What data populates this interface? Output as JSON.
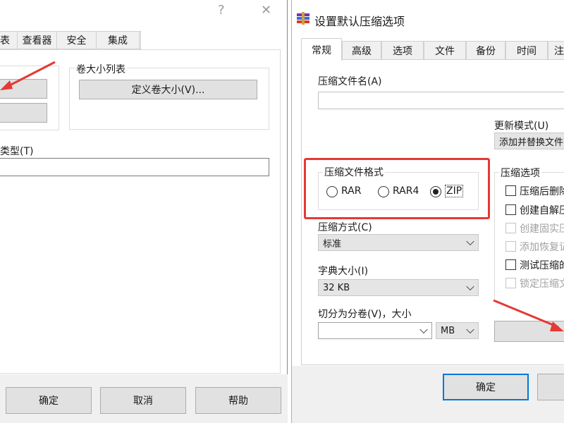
{
  "left_dialog": {
    "title_help": "?",
    "title_close": "✕",
    "tabs": [
      "表",
      "查看器",
      "安全",
      "集成"
    ],
    "volume_group_title": "卷大小列表",
    "define_volume_button": "定义卷大小(V)...",
    "type_label": "类型(T)",
    "type_value": "",
    "footer_buttons": [
      "确定",
      "取消",
      "帮助"
    ]
  },
  "right_dialog": {
    "title": "设置默认压缩选项",
    "tabs": [
      "常规",
      "高级",
      "选项",
      "文件",
      "备份",
      "时间",
      "注"
    ],
    "archive_name_label": "压缩文件名(A)",
    "archive_name_value": "",
    "update_mode_label": "更新模式(U)",
    "update_mode_value": "添加并替换文件",
    "format_group_title": "压缩文件格式",
    "formats": [
      {
        "label": "RAR",
        "selected": false
      },
      {
        "label": "RAR4",
        "selected": false
      },
      {
        "label": "ZIP",
        "selected": true
      }
    ],
    "method_label": "压缩方式(C)",
    "method_value": "标准",
    "dict_label": "字典大小(I)",
    "dict_value": "32 KB",
    "split_label": "切分为分卷(V)，大小",
    "split_value": "",
    "split_unit": "MB",
    "options_group_title": "压缩选项",
    "options": [
      {
        "label": "压缩后删除",
        "enabled": true
      },
      {
        "label": "创建自解压",
        "enabled": true
      },
      {
        "label": "创建固实压",
        "enabled": false
      },
      {
        "label": "添加恢复记",
        "enabled": false
      },
      {
        "label": "测试压缩的",
        "enabled": true
      },
      {
        "label": "锁定压缩文",
        "enabled": false
      }
    ],
    "ok_button": "确定"
  },
  "colors": {
    "annotation_red": "#e53935",
    "footer_bg": "#f0f0f0",
    "button_bg": "#e1e1e1",
    "focus_blue": "#0078d7"
  }
}
